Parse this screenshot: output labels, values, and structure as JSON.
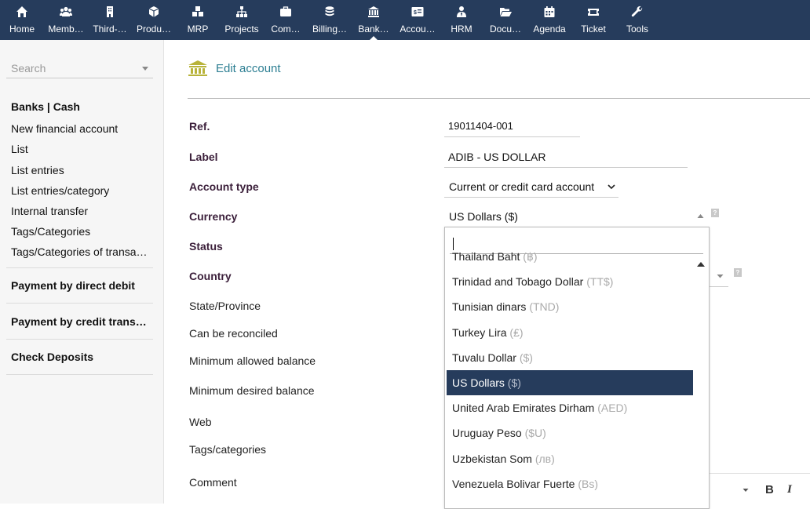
{
  "topnav": [
    {
      "label": "Home",
      "icon": "home-icon"
    },
    {
      "label": "Memb…",
      "icon": "members-icon"
    },
    {
      "label": "Third-…",
      "icon": "building-icon"
    },
    {
      "label": "Produ…",
      "icon": "cube-icon"
    },
    {
      "label": "MRP",
      "icon": "cubes-icon"
    },
    {
      "label": "Projects",
      "icon": "sitemap-icon"
    },
    {
      "label": "Com…",
      "icon": "briefcase-icon"
    },
    {
      "label": "Billing…",
      "icon": "coins-icon"
    },
    {
      "label": "Bank…",
      "icon": "bank-icon"
    },
    {
      "label": "Accou…",
      "icon": "accounting-icon"
    },
    {
      "label": "HRM",
      "icon": "user-tie-icon"
    },
    {
      "label": "Docu…",
      "icon": "folder-open-icon"
    },
    {
      "label": "Agenda",
      "icon": "calendar-icon"
    },
    {
      "label": "Ticket",
      "icon": "ticket-icon"
    },
    {
      "label": "Tools",
      "icon": "wrench-icon"
    }
  ],
  "sidebar": {
    "search_placeholder": "Search",
    "section1_title": "Banks | Cash",
    "items": [
      "New financial account",
      "List",
      "List entries",
      "List entries/category",
      "Internal transfer",
      "Tags/Categories",
      "Tags/Categories of transa…"
    ],
    "section2_title": "Payment by direct debit",
    "section3_title": "Payment by credit transa…",
    "section4_title": "Check Deposits"
  },
  "page": {
    "title": "Edit account"
  },
  "form": {
    "ref_label": "Ref.",
    "ref_value": "19011404-001",
    "label_label": "Label",
    "label_value": "ADIB - US DOLLAR",
    "account_type_label": "Account type",
    "account_type_value": "Current or credit card account",
    "currency_label": "Currency",
    "currency_value": "US Dollars ($)",
    "status_label": "Status",
    "country_label": "Country",
    "state_label": "State/Province",
    "reconcile_label": "Can be reconciled",
    "min_allowed_label": "Minimum allowed balance",
    "min_desired_label": "Minimum desired balance",
    "web_label": "Web",
    "tags_label": "Tags/categories",
    "comment_label": "Comment"
  },
  "currency_dropdown": {
    "search_value": "",
    "options": [
      {
        "name": "Thailand Baht",
        "symbol": "(฿)"
      },
      {
        "name": "Trinidad and Tobago Dollar",
        "symbol": "(TT$)"
      },
      {
        "name": "Tunisian dinars",
        "symbol": "(TND)"
      },
      {
        "name": "Turkey Lira",
        "symbol": "(₤)"
      },
      {
        "name": "Tuvalu Dollar",
        "symbol": "($)"
      },
      {
        "name": "US Dollars",
        "symbol": "($)",
        "selected": true
      },
      {
        "name": "United Arab Emirates Dirham",
        "symbol": "(AED)"
      },
      {
        "name": "Uruguay Peso",
        "symbol": "($U)"
      },
      {
        "name": "Uzbekistan Som",
        "symbol": "(лв)"
      },
      {
        "name": "Venezuela Bolivar Fuerte",
        "symbol": "(Bs)"
      }
    ]
  },
  "editor_toolbar": {
    "bold": "B",
    "italic": "I"
  },
  "colors": {
    "topbar": "#263c5c",
    "selected": "#263c5c",
    "title": "#2c7e92",
    "required_label": "#3b1f3a",
    "bank_icon": "#b8b33a"
  }
}
